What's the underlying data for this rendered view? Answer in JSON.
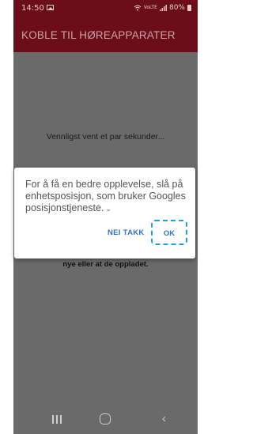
{
  "status_bar": {
    "time": "14:50",
    "signal_label": "VoLTE",
    "battery_percent": "80%",
    "icons": [
      "gallery-icon",
      "wifi-icon",
      "signal-icon",
      "battery-icon"
    ]
  },
  "app_bar": {
    "title": "KOBLE TIL HØREAPPARATER"
  },
  "content": {
    "wait_text": "Vennligst vent et par sekunder...",
    "hint_text": "nye eller at de oppladet."
  },
  "dialog": {
    "message": "For å få en bedre opplevelse, slå på enhetsposisjon, som bruker Googles posisjonstjeneste.",
    "expand_icon": "chevron-down-icon",
    "no_thanks_label": "NEI TAKK",
    "ok_label": "OK",
    "button_color": "#2a73c9",
    "highlight_color": "#1ba2e0"
  },
  "nav_bar": {
    "icons": [
      "recents-icon",
      "home-icon",
      "back-icon"
    ]
  },
  "colors": {
    "header": "#6b0e19",
    "scrim": "#6a6a6a"
  }
}
